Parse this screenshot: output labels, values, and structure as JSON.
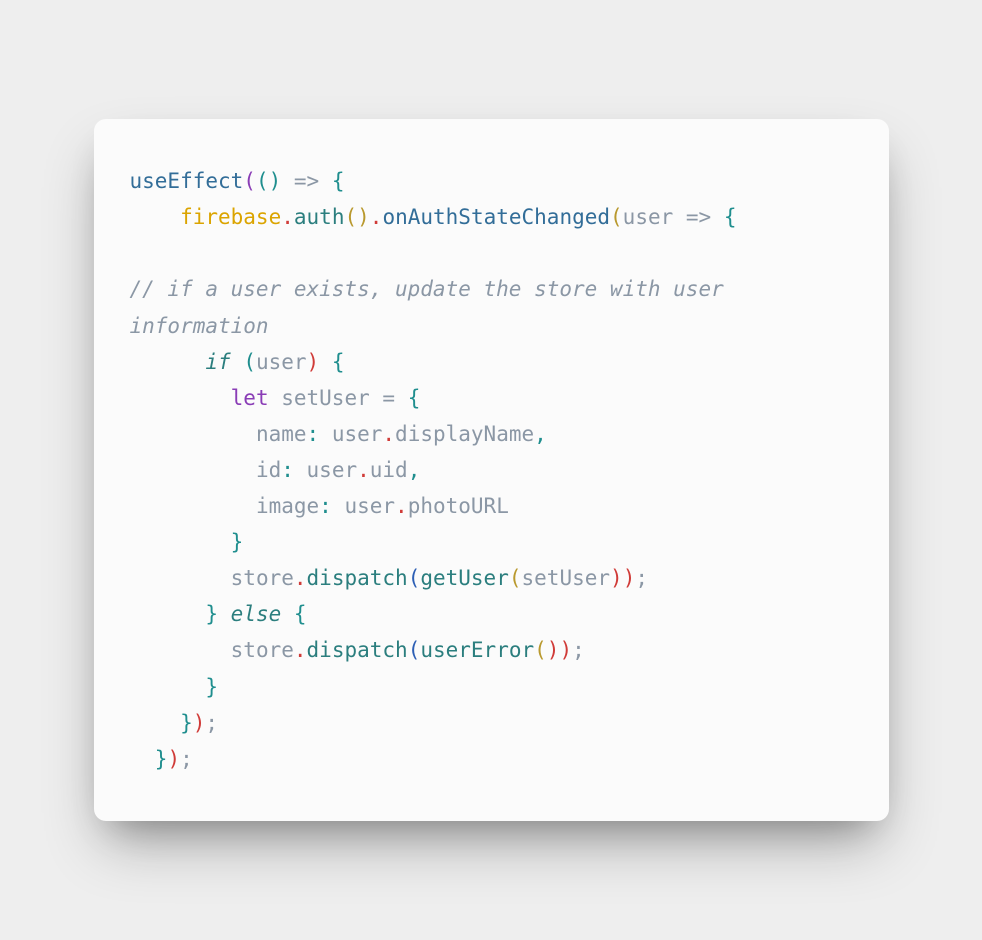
{
  "code": {
    "t1": "useEffect",
    "t2": "(",
    "t3": "(",
    "t4": ")",
    "t5": " => ",
    "t6": "{",
    "t7": "    ",
    "t8": "firebase",
    "t9": ".",
    "t10": "auth",
    "t11": "(",
    "t12": ")",
    "t13": ".",
    "t14": "onAuthStateChanged",
    "t15": "(",
    "t16": "user",
    "t17": " => ",
    "t18": "{",
    "t20": "// if a user exists, update the store with user information",
    "t21": "      ",
    "t22": "if",
    "t23": " ",
    "t24": "(",
    "t25": "user",
    "t26": ")",
    "t27": " ",
    "t28": "{",
    "t29": "        ",
    "t30": "let",
    "t31": " setUser ",
    "t32": "=",
    "t33": " ",
    "t34": "{",
    "t35": "          name",
    "t36": ":",
    "t37": " user",
    "t38": ".",
    "t39": "displayName",
    "t40": ",",
    "t41": "          id",
    "t42": ":",
    "t43": " user",
    "t44": ".",
    "t45": "uid",
    "t46": ",",
    "t47": "          image",
    "t48": ":",
    "t49": " user",
    "t50": ".",
    "t51": "photoURL",
    "t52": "        ",
    "t53": "}",
    "t54": "        store",
    "t55": ".",
    "t56": "dispatch",
    "t57": "(",
    "t58": "getUser",
    "t59": "(",
    "t60": "setUser",
    "t61": ")",
    "t62": ")",
    "t63": ";",
    "t64": "      ",
    "t65": "}",
    "t66": " ",
    "t67": "else",
    "t68": " ",
    "t69": "{",
    "t70": "        store",
    "t71": ".",
    "t72": "dispatch",
    "t73": "(",
    "t74": "userError",
    "t75": "(",
    "t76": ")",
    "t77": ")",
    "t78": ";",
    "t79": "      ",
    "t80": "}",
    "t81": "    ",
    "t82": "}",
    "t83": ")",
    "t84": ";",
    "t85": "  ",
    "t86": "}",
    "t87": ")",
    "t88": ";"
  }
}
